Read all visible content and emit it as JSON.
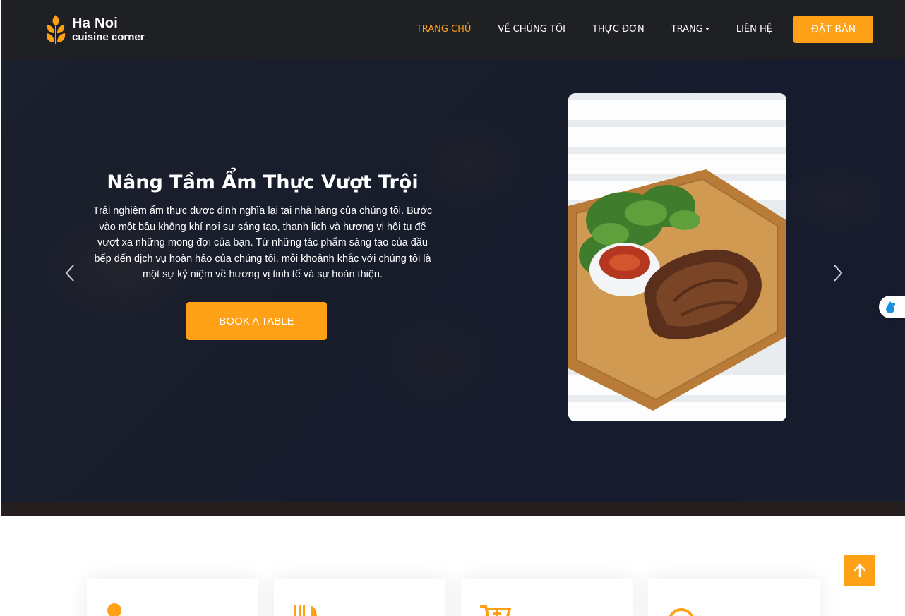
{
  "brand": {
    "line1": "Ha Noi",
    "line2": "cuisine corner",
    "icon": "wheat-icon",
    "accent": "#fea116"
  },
  "nav": {
    "items": [
      {
        "label": "TRANG CHỦ",
        "active": true
      },
      {
        "label": "VỀ CHÚNG TÔI",
        "active": false
      },
      {
        "label": "THỰC ĐƠN",
        "active": false
      },
      {
        "label": "TRANG",
        "active": false,
        "dropdown": true
      },
      {
        "label": "LIÊN HỆ",
        "active": false
      }
    ],
    "cta": "ĐẶT BÀN"
  },
  "hero": {
    "title": "Nâng Tầm Ẩm Thực Vượt Trội",
    "description": "Trải nghiệm ẩm thực được định nghĩa lại tại nhà hàng của chúng tôi. Bước vào một bầu không khí nơi sự sáng tạo, thanh lịch và hương vị hội tụ để vượt xa những mong đợi của bạn. Từ những tác phẩm sáng tạo của đầu bếp đến dịch vụ hoàn hảo của chúng tôi, mỗi khoảnh khắc với chúng tôi là một sự kỷ niệm về hương vị tinh tế và sự hoàn thiện.",
    "cta": "BOOK A TABLE",
    "prev_icon": "chevron-left-icon",
    "next_icon": "chevron-right-icon",
    "photo": "steak-on-board-photo"
  },
  "services": {
    "icons": [
      "user-icon",
      "utensils-icon",
      "cart-icon",
      "headset-icon"
    ]
  },
  "back_to_top_icon": "arrow-up-icon"
}
